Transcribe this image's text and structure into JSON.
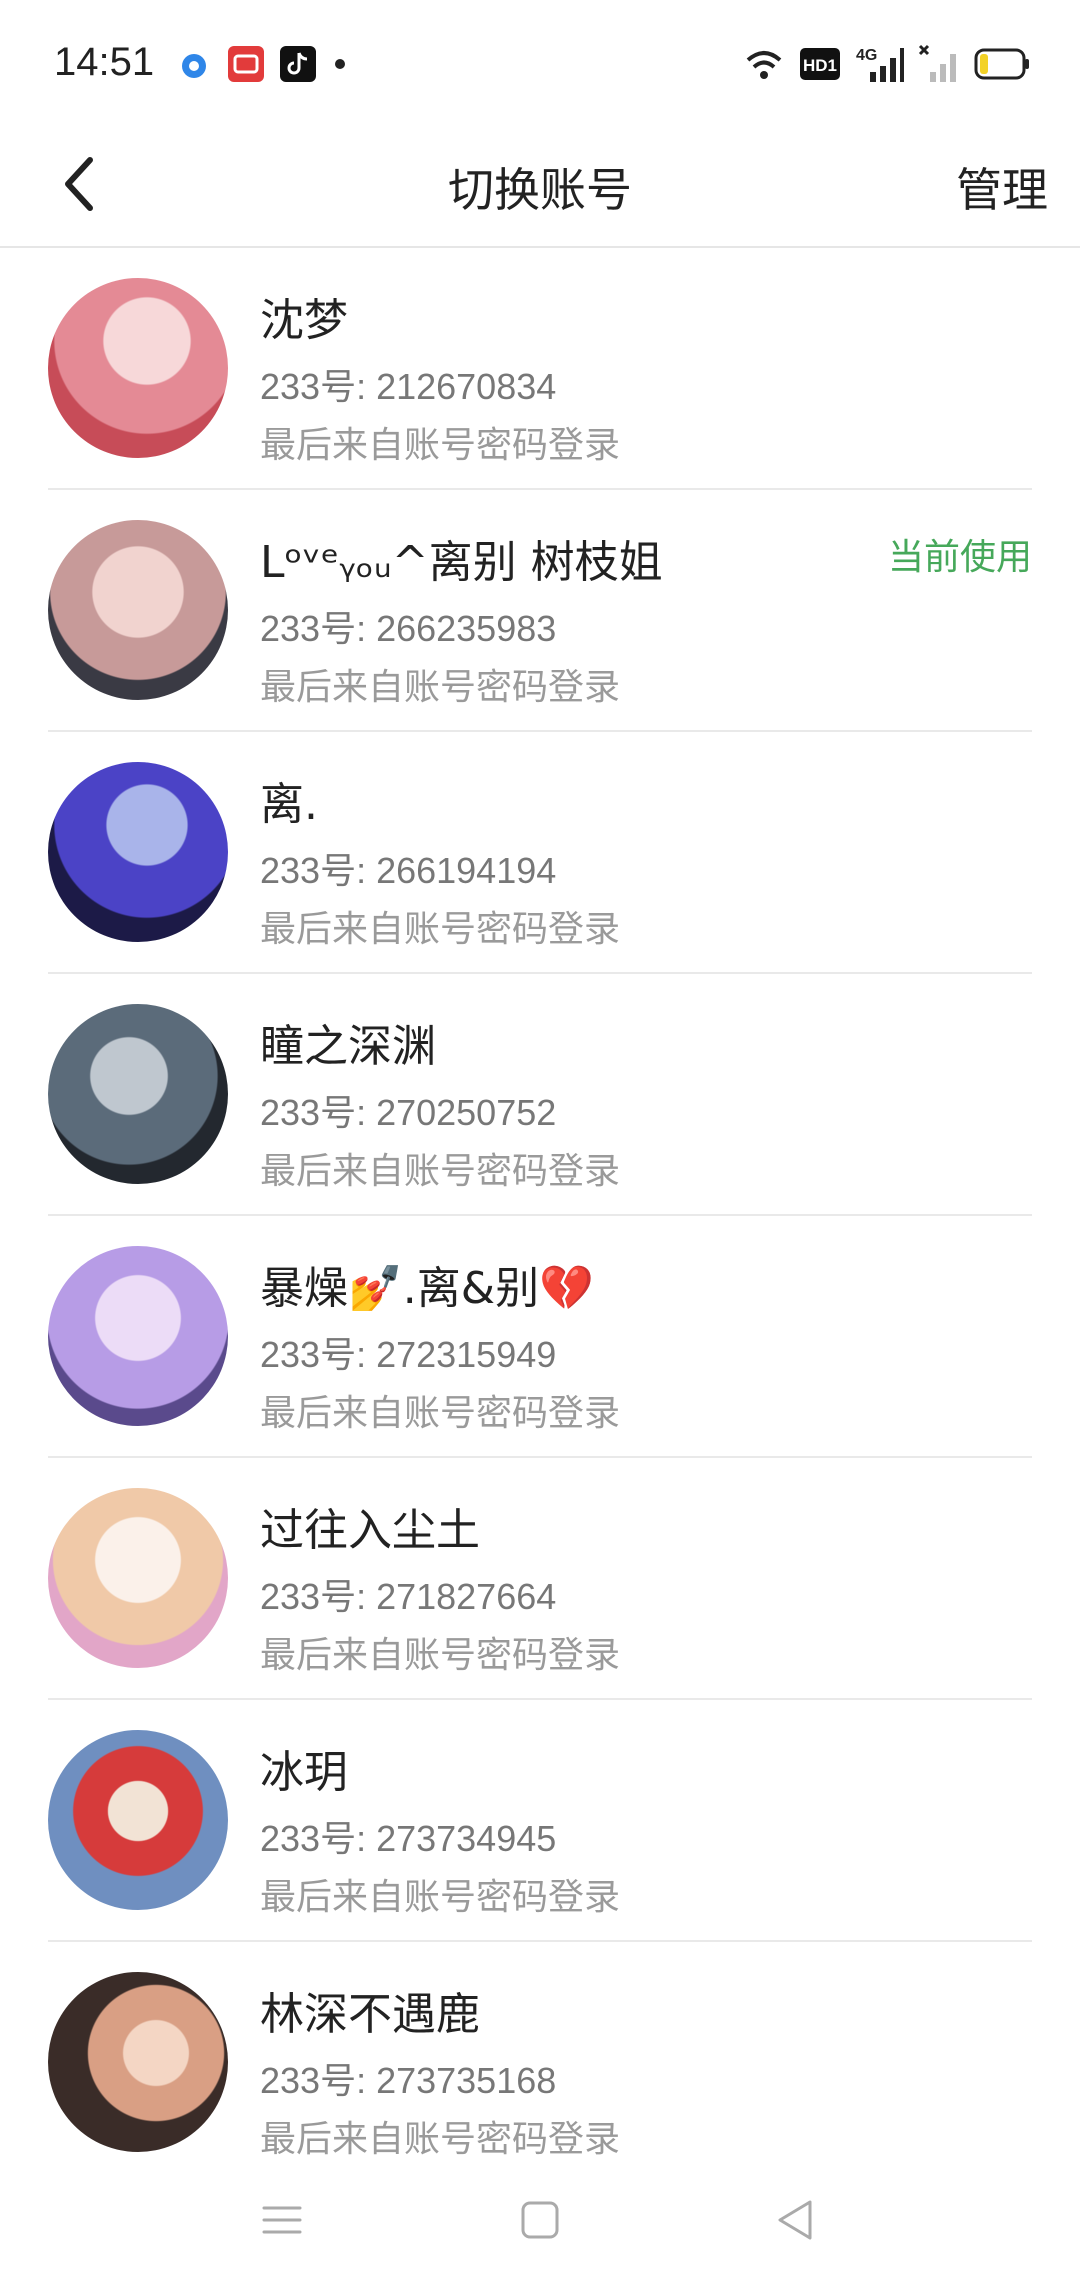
{
  "status_bar": {
    "time": "14:51",
    "icons": [
      "circle-app-icon",
      "red-app-icon",
      "tiktok-icon",
      "dot-icon",
      "wifi-icon",
      "hd-icon",
      "4g-signal-icon",
      "no-signal-icon",
      "battery-icon"
    ],
    "hd_label": "HD1",
    "network_label": "4G"
  },
  "header": {
    "back_icon": "chevron-left-icon",
    "title": "切换账号",
    "manage_label": "管理"
  },
  "accounts": [
    {
      "name": "沈梦",
      "number": "233号: 212670834",
      "method": "最后来自账号密码登录",
      "badge": "",
      "avatar_colors": [
        "#f7d8d9",
        "#e48a95",
        "#c74c58"
      ]
    },
    {
      "name": "Lᵒᵛᵉᵧₒᵤ^离别   树枝姐",
      "number": "233号: 266235983",
      "method": "最后来自账号密码登录",
      "badge": "当前使用",
      "avatar_colors": [
        "#f1d3cf",
        "#c79a99",
        "#3a3a44"
      ]
    },
    {
      "name": "离.",
      "number": "233号: 266194194",
      "method": "最后来自账号密码登录",
      "badge": "",
      "avatar_colors": [
        "#a9b4ea",
        "#4b43c6",
        "#1c1a47"
      ]
    },
    {
      "name": "瞳之深渊",
      "number": "233号: 270250752",
      "method": "最后来自账号密码登录",
      "badge": "",
      "avatar_colors": [
        "#bfc7cf",
        "#5b6b7a",
        "#23282f"
      ]
    },
    {
      "name": "暴燥💅.离&别💔",
      "number": "233号: 272315949",
      "method": "最后来自账号密码登录",
      "badge": "",
      "avatar_colors": [
        "#ecdcf7",
        "#b79ce6",
        "#5a4a8c"
      ]
    },
    {
      "name": "过往入尘土",
      "number": "233号: 271827664",
      "method": "最后来自账号密码登录",
      "badge": "",
      "avatar_colors": [
        "#fbf1ea",
        "#f0c9a8",
        "#e2a6c8"
      ]
    },
    {
      "name": "冰玥",
      "number": "233号: 273734945",
      "method": "最后来自账号密码登录",
      "badge": "",
      "avatar_colors": [
        "#6f8fc0",
        "#d63b3b",
        "#f2e3d5"
      ]
    },
    {
      "name": "林深不遇鹿",
      "number": "233号: 273735168",
      "method": "最后来自账号密码登录",
      "badge": "",
      "avatar_colors": [
        "#3a2c28",
        "#d99f84",
        "#f4d6c4"
      ]
    }
  ],
  "nav_bar": {
    "icons": [
      "menu-icon",
      "home-square-icon",
      "back-triangle-icon"
    ]
  }
}
